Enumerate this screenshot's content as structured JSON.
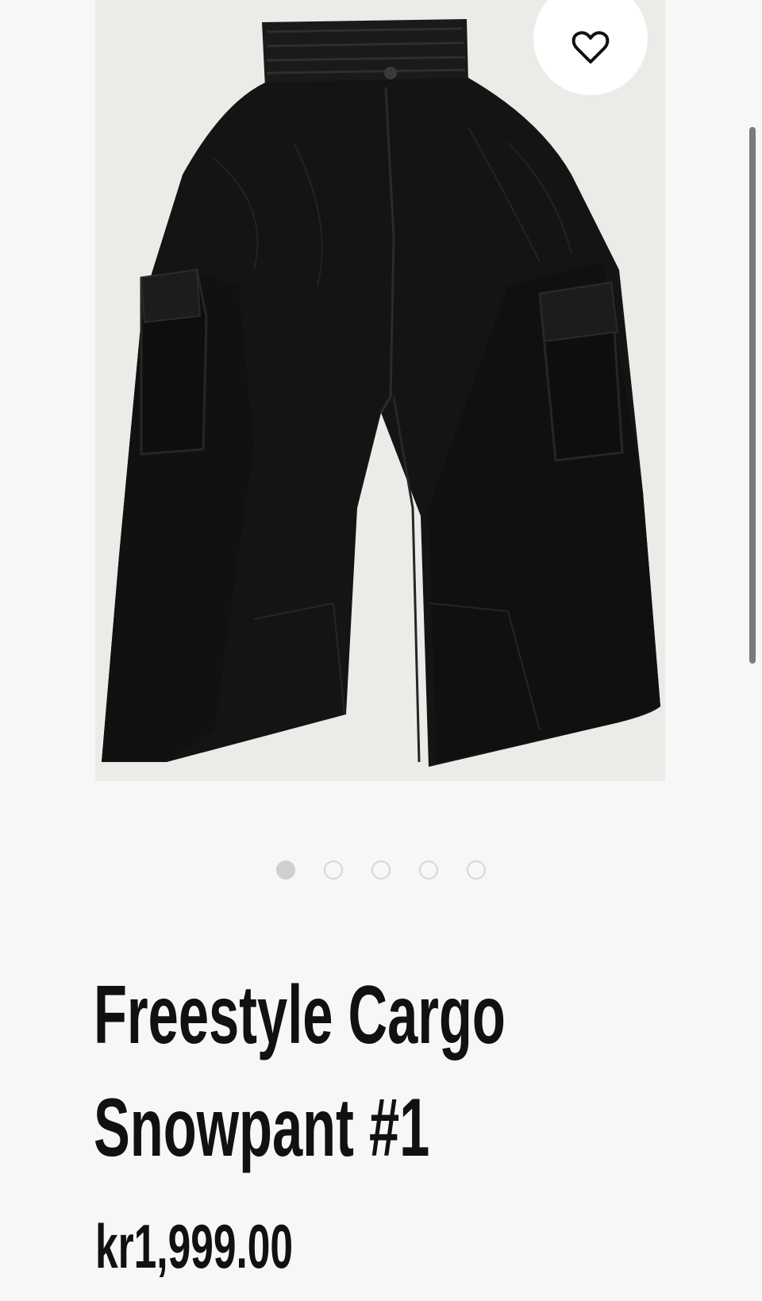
{
  "product": {
    "title_line1": "Freestyle Cargo",
    "title_line2": "Snowpant #1",
    "price": "kr1,999.00",
    "image_alt": "Black cargo snow pants",
    "image_count": 5,
    "active_image_index": 0
  },
  "icons": {
    "wishlist": "heart-outline-icon"
  },
  "colors": {
    "background": "#f7f7f7",
    "text": "#111111",
    "pants": "#141414",
    "dot_active": "#cfcfcf",
    "dot_inactive_border": "#d6d6d6"
  }
}
